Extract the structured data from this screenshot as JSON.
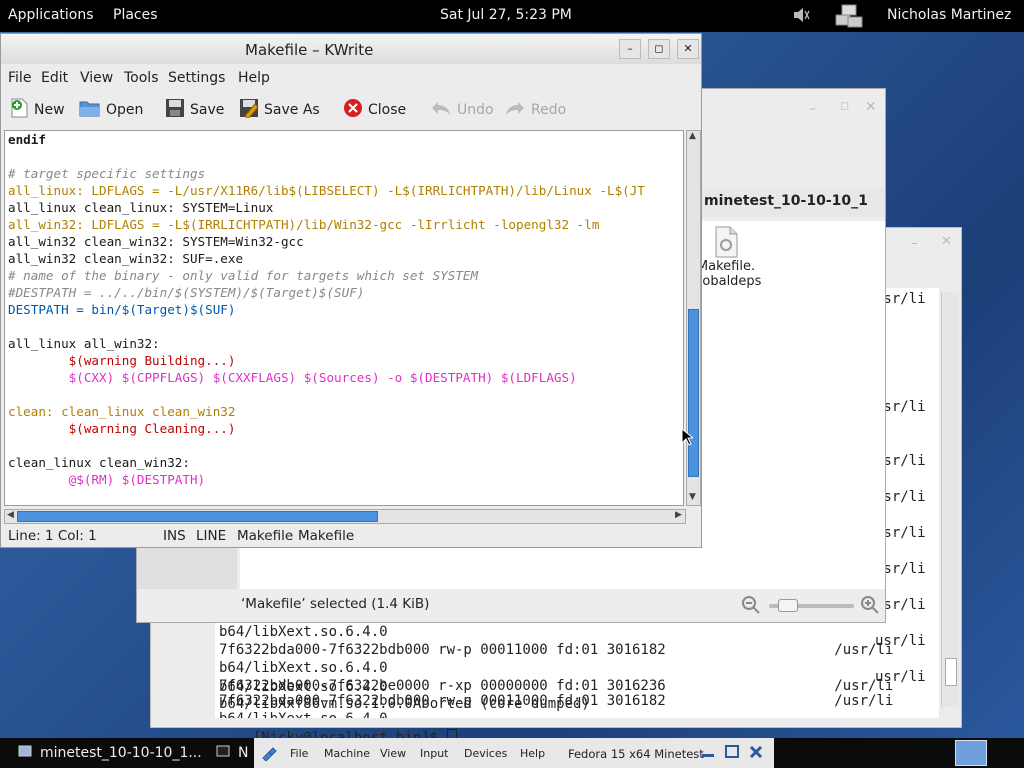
{
  "top_panel": {
    "applications": "Applications",
    "places": "Places",
    "clock": "Sat Jul 27,  5:23 PM",
    "user": "Nicholas Martinez"
  },
  "kwrite": {
    "title": "Makefile – KWrite",
    "menu": [
      "File",
      "Edit",
      "View",
      "Tools",
      "Settings",
      "Help"
    ],
    "toolbar": {
      "new": "New",
      "open": "Open",
      "save": "Save",
      "save_as": "Save As",
      "close": "Close",
      "undo": "Undo",
      "redo": "Redo"
    },
    "status": {
      "position": "Line: 1 Col: 1",
      "mode": "INS",
      "select_mode": "LINE",
      "filetype": "Makefile",
      "encoding_type": "Makefile"
    },
    "code": [
      "endif",
      "",
      "# target specific settings",
      "all_linux: LDFLAGS = -L/usr/X11R6/lib$(LIBSELECT) -L$(IRRLICHTPATH)/lib/Linux -L$(JT",
      "all_linux clean_linux: SYSTEM=Linux",
      "all_win32: LDFLAGS = -L$(IRRLICHTPATH)/lib/Win32-gcc -lIrrlicht -lopengl32 -lm",
      "all_win32 clean_win32: SYSTEM=Win32-gcc",
      "all_win32 clean_win32: SUF=.exe",
      "# name of the binary - only valid for targets which set SYSTEM",
      "#DESTPATH = ../../bin/$(SYSTEM)/$(Target)$(SUF)",
      "DESTPATH = bin/$(Target)$(SUF)",
      "",
      "all_linux all_win32:",
      "        $(warning Building...)",
      "        $(CXX) $(CPPFLAGS) $(CXXFLAGS) $(Sources) -o $(DESTPATH) $(LDFLAGS)",
      "",
      "clean: clean_linux clean_win32",
      "        $(warning Cleaning...)",
      "",
      "clean_linux clean_win32:",
      "        @$(RM) $(DESTPATH)"
    ]
  },
  "file_manager": {
    "folder_tab": "minetest_10-10-10_1",
    "file_name": "Makefile.\nglobaldeps",
    "status": "‘Makefile’ selected (1.4 KiB)"
  },
  "terminal": {
    "right_col": "usr/li",
    "lines": [
      "b64/libXext.so.6.4.0",
      "7f6322bda000-7f6322bdb000 rw-p 00011000 fd:01 3016182                    /usr/li",
      "b64/libXext.so.6.4.0",
      "7f6322bdb000-7f6322be0000 r-xp 00000000 fd:01 3016236                    /usr/li",
      "b64/libXxf86vm.so.1.0.0Aborted (core dumped)",
      "[Nicky@localhost bin]$ "
    ]
  },
  "taskbar": {
    "item1": "minetest_10-10-10_1...",
    "item2": "N",
    "vm_menu": [
      "File",
      "Machine",
      "View",
      "Input",
      "Devices",
      "Help"
    ],
    "vm_title": "Fedora 15 x64 Minetest"
  },
  "colors": {
    "accent_blue": "#3c7fd4",
    "scrollbar_blue": "#4b92df"
  }
}
